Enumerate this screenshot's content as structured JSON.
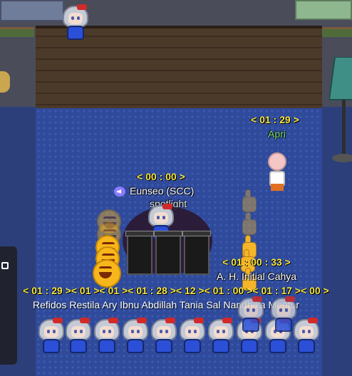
{
  "scene": {
    "name": "virtual-office-spotlight-area"
  },
  "labels": {
    "apri_timer": "< 01 : 29 >",
    "apri_name": "Apri",
    "eunseo_timer": "< 00 : 00 >",
    "eunseo_name": "Eunseo (SCC)",
    "spotlight_text": "spotlight",
    "cahya_timer": "< 01 : 00 : 33 >",
    "cahya_name": "A. H. Initial Cahya",
    "bottom_timers": "< 01 : 29 >< 01 >< 01 >< 01 : 28 >< 12 >< 01 : 00 >< 01 : 17 >< 00 >",
    "bottom_names": "Refidos Restila Ary Ibnu Abdillah Tania Sal Nandhika Mentor"
  },
  "colors": {
    "timer": "#f6e84a",
    "name": "#ffffff",
    "apri_name": "#7fe07f",
    "carpet": "#2f4a9a",
    "stage_wood": "#4b3a2a"
  },
  "icons": {
    "speaker": "speaker-icon",
    "emoji_reaction": "laughing-emoji-icon",
    "thumbs_up": "thumbs-up-icon"
  }
}
